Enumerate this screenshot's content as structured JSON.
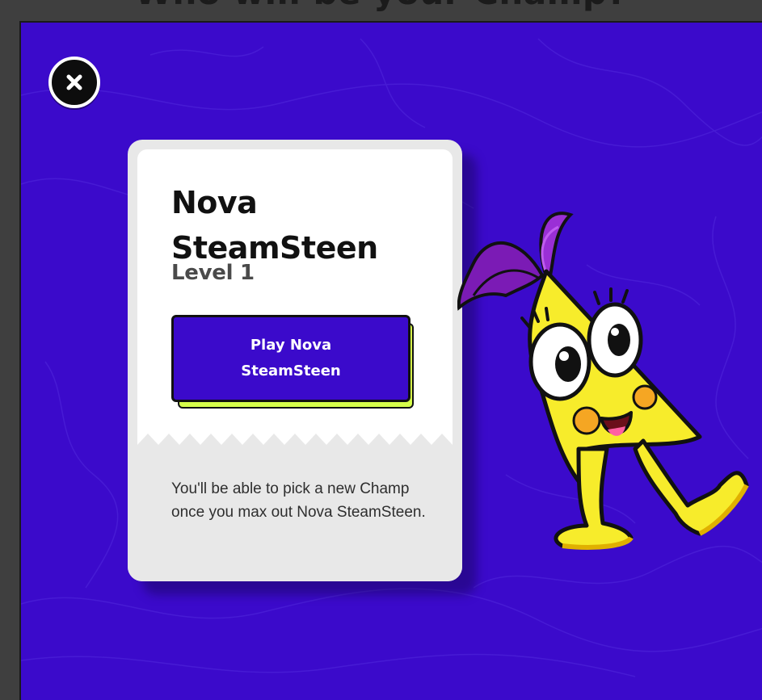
{
  "header": {
    "title": "Who will be your Champ?"
  },
  "modal": {
    "close_icon": "close-icon"
  },
  "champ_card": {
    "name": "Nova SteamSteen",
    "level": "Level 1",
    "play_button_label": "Play Nova SteamSteen",
    "description": "You'll be able to pick a new Champ once you max out Nova SteamSteen."
  },
  "colors": {
    "modal_background": "#3b0acb",
    "button_primary": "#3b0acb",
    "button_accent": "#d6ff4a",
    "card_background": "#ffffff",
    "card_footer": "#e8e8e8",
    "mascot_body": "#f7ec2b",
    "mascot_hair": "#7b1bb5"
  }
}
